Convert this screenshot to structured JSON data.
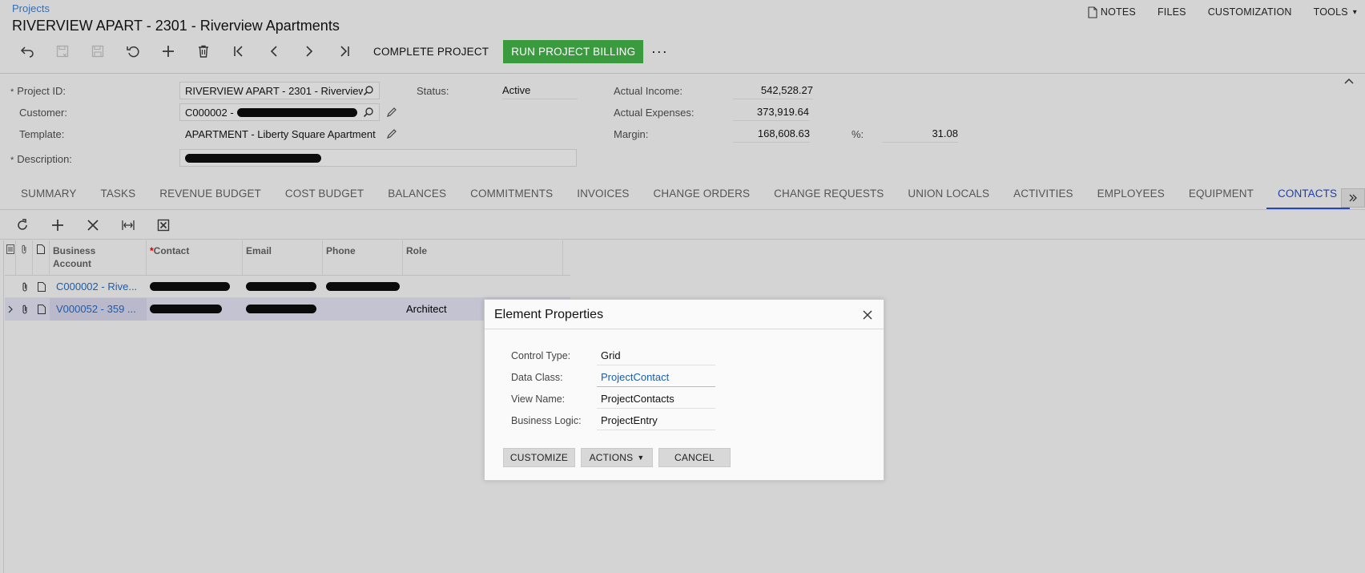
{
  "header": {
    "breadcrumb": "Projects",
    "title": "RIVERVIEW APART - 2301 - Riverview Apartments",
    "links": [
      "NOTES",
      "FILES",
      "CUSTOMIZATION",
      "TOOLS"
    ]
  },
  "toolbar": {
    "complete_label": "COMPLETE PROJECT",
    "billing_label": "RUN PROJECT BILLING",
    "more_label": "···",
    "billing_color": "#3a9a3e"
  },
  "form": {
    "project_id": {
      "label": "Project ID:",
      "value": "RIVERVIEW APART - 2301 - Riverview Apartments"
    },
    "customer": {
      "label": "Customer:",
      "value": "C000002 -"
    },
    "template": {
      "label": "Template:",
      "value": "APARTMENT - Liberty Square Apartment"
    },
    "description": {
      "label": "Description:"
    },
    "status": {
      "label": "Status:",
      "value": "Active"
    },
    "actual_income": {
      "label": "Actual Income:",
      "value": "542,528.27"
    },
    "actual_expenses": {
      "label": "Actual Expenses:",
      "value": "373,919.64"
    },
    "margin": {
      "label": "Margin:",
      "value": "168,608.63"
    },
    "percent": {
      "label": "%:",
      "value": "31.08"
    },
    "required_mark": "*"
  },
  "tabs": [
    "SUMMARY",
    "TASKS",
    "REVENUE BUDGET",
    "COST BUDGET",
    "BALANCES",
    "COMMITMENTS",
    "INVOICES",
    "CHANGE ORDERS",
    "CHANGE REQUESTS",
    "UNION LOCALS",
    "ACTIVITIES",
    "EMPLOYEES",
    "EQUIPMENT",
    "CONTACTS"
  ],
  "active_tab": "CONTACTS",
  "grid": {
    "columns": {
      "business_account_1": "Business",
      "business_account_2": "Account",
      "contact": "Contact",
      "email": "Email",
      "phone": "Phone",
      "role": "Role"
    },
    "rows": [
      {
        "business_account": "C000002 - Rive...",
        "role": ""
      },
      {
        "business_account": "V000052 - 359 ...",
        "role": "Architect"
      }
    ]
  },
  "dialog": {
    "title": "Element Properties",
    "control_type": {
      "label": "Control Type:",
      "value": "Grid"
    },
    "data_class": {
      "label": "Data Class:",
      "value": "ProjectContact"
    },
    "view_name": {
      "label": "View Name:",
      "value": "ProjectContacts"
    },
    "business_logic": {
      "label": "Business Logic:",
      "value": "ProjectEntry"
    },
    "buttons": {
      "customize": "CUSTOMIZE",
      "actions": "ACTIONS",
      "cancel": "CANCEL"
    }
  }
}
